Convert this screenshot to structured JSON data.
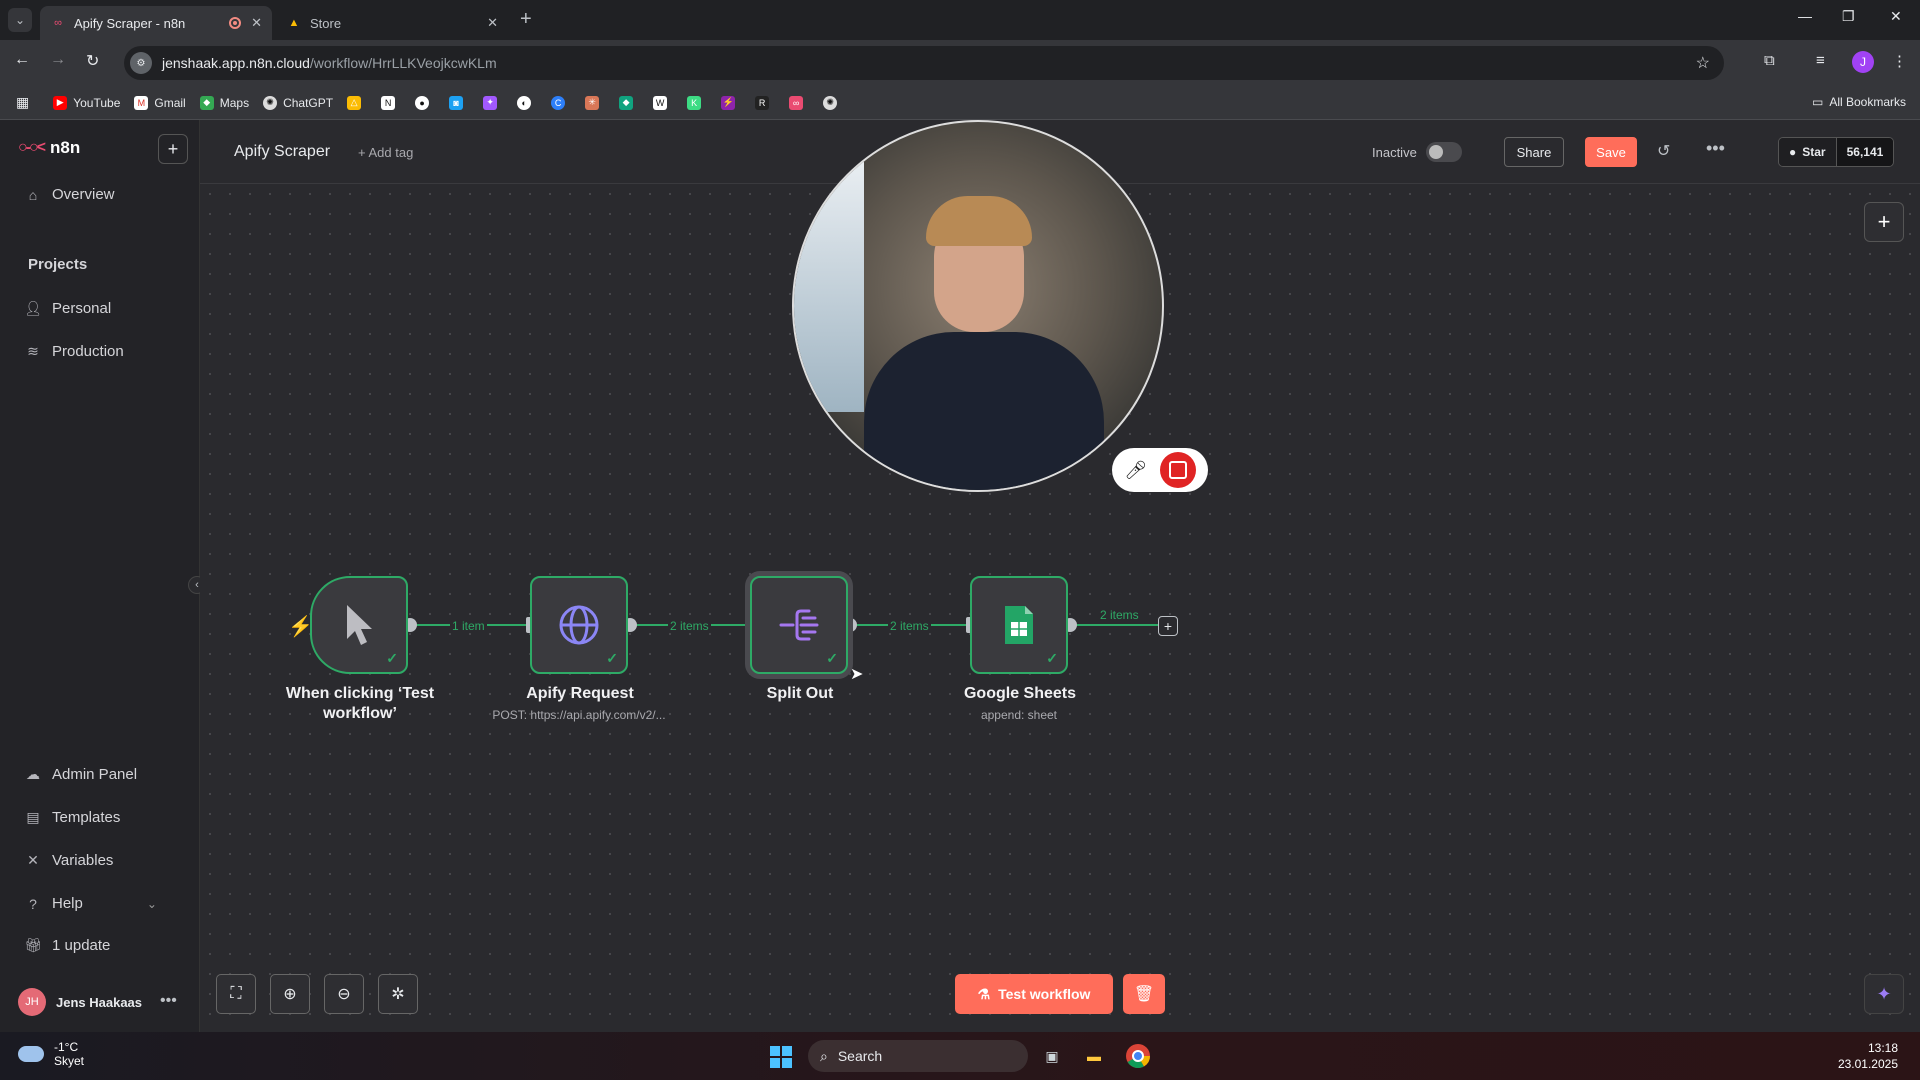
{
  "browser": {
    "tabs": [
      {
        "title": "Apify Scraper - n8n",
        "active": true,
        "recording": true
      },
      {
        "title": "Store",
        "active": false
      }
    ],
    "url_host": "jenshaak.app.n8n.cloud",
    "url_path": "/workflow/HrrLLKVeojkcwKLm",
    "profile_initial": "J",
    "bookmarks": [
      "YouTube",
      "Gmail",
      "Maps",
      "ChatGPT"
    ],
    "all_bookmarks": "All Bookmarks"
  },
  "sidebar": {
    "brand": "n8n",
    "overview": "Overview",
    "projects_heading": "Projects",
    "projects": [
      "Personal",
      "Production"
    ],
    "bottom_items": [
      "Admin Panel",
      "Templates",
      "Variables",
      "Help",
      "1 update"
    ],
    "user_initials": "JH",
    "user_name": "Jens Haakaas"
  },
  "header": {
    "workflow_name": "Apify Scraper",
    "add_tag": "+ Add tag",
    "status": "Inactive",
    "share": "Share",
    "save": "Save",
    "github_star": "Star",
    "github_count": "56,141"
  },
  "workflow": {
    "nodes": [
      {
        "name": "When clicking ‘Test workflow’",
        "subtitle": "",
        "icon": "cursor-icon"
      },
      {
        "name": "Apify Request",
        "subtitle": "POST: https://api.apify.com/v2/...",
        "icon": "globe-icon"
      },
      {
        "name": "Split Out",
        "subtitle": "",
        "icon": "split-out-icon"
      },
      {
        "name": "Google Sheets",
        "subtitle": "append: sheet",
        "icon": "google-sheets-icon"
      }
    ],
    "edges": [
      "1 item",
      "2 items",
      "2 items",
      "2 items"
    ]
  },
  "canvas_controls": {
    "test_workflow": "Test workflow"
  },
  "taskbar": {
    "temperature": "-1°C",
    "weather": "Skyet",
    "search": "Search",
    "time": "13:18",
    "date": "23.01.2025"
  },
  "colors": {
    "accent": "#ff6d5a",
    "success": "#2eaa66",
    "brand": "#ea4b71"
  }
}
